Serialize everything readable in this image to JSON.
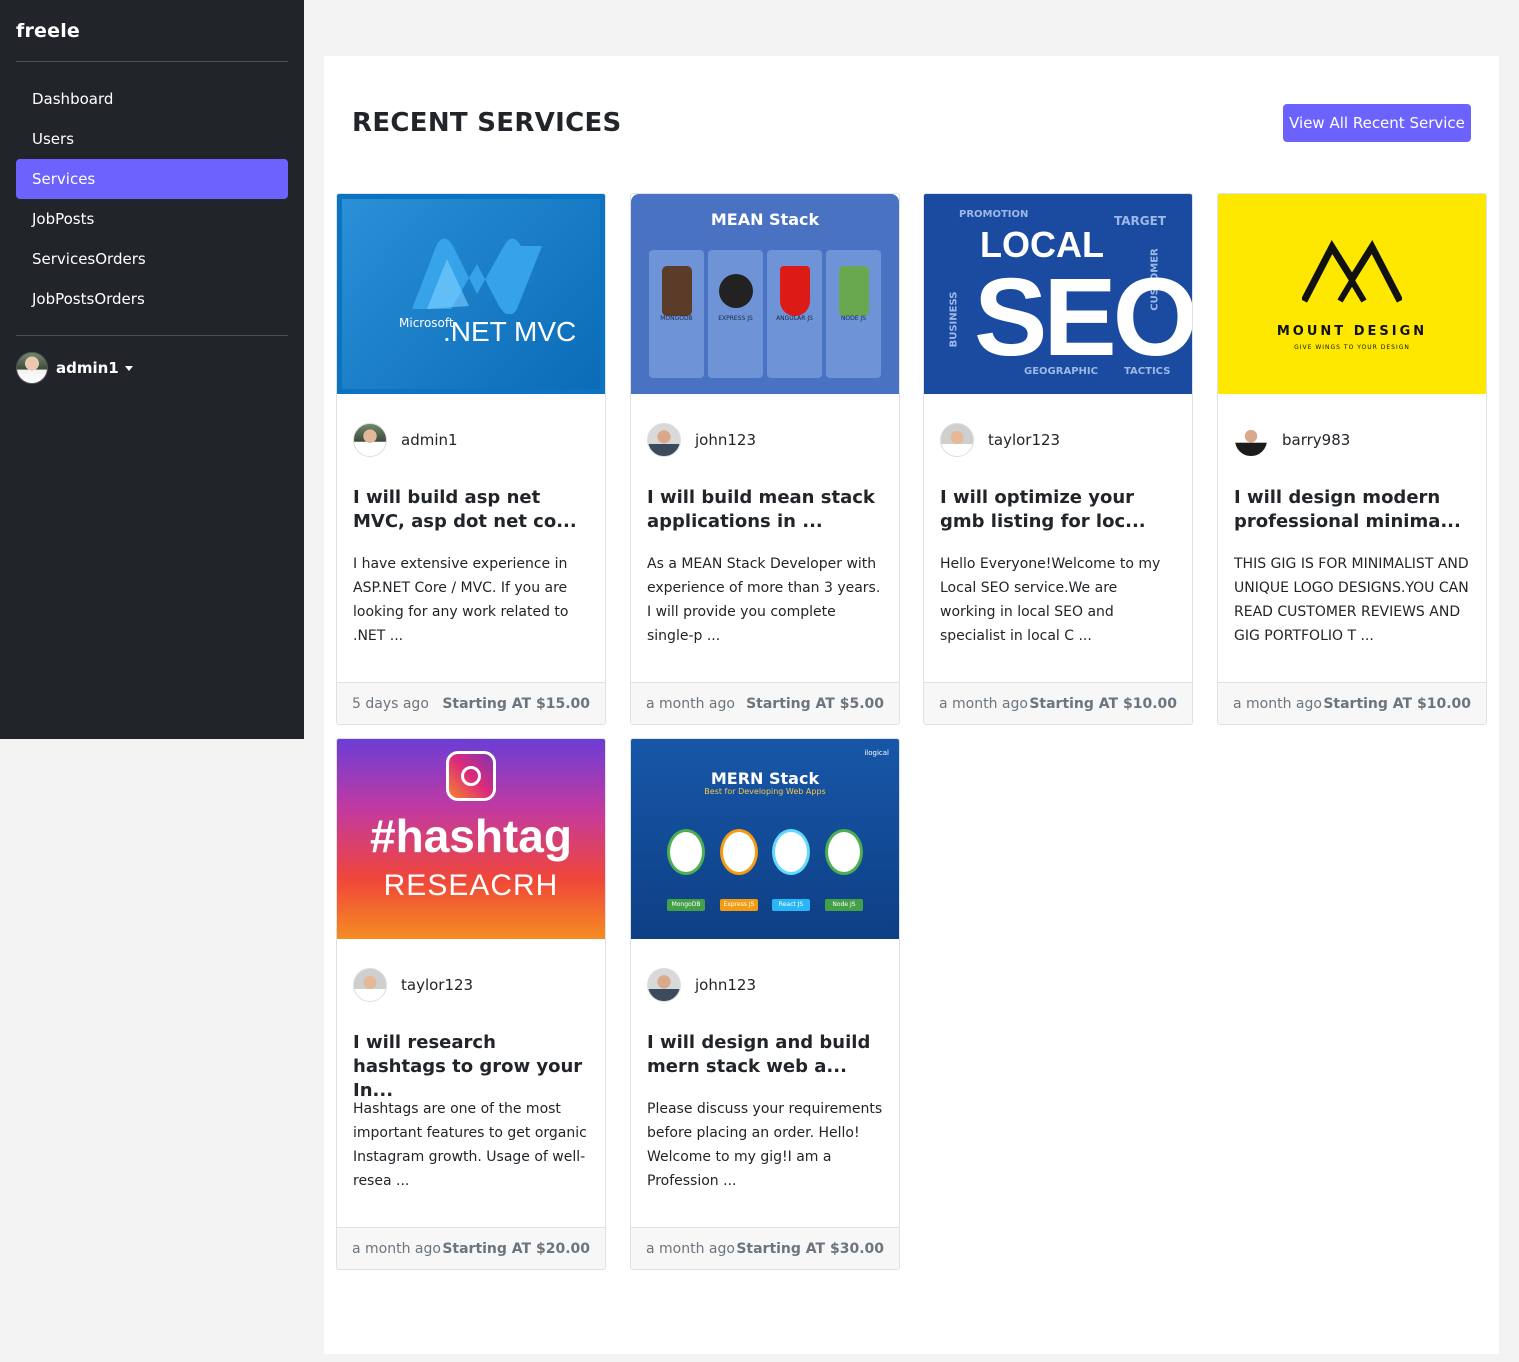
{
  "brand": "freele",
  "nav": [
    {
      "label": "Dashboard"
    },
    {
      "label": "Users"
    },
    {
      "label": "Services",
      "active": true
    },
    {
      "label": "JobPosts"
    },
    {
      "label": "ServicesOrders"
    },
    {
      "label": "JobPostsOrders"
    }
  ],
  "user": {
    "name": "admin1"
  },
  "main": {
    "title": "RECENT SERVICES",
    "view_all_label": "View All Recent Service"
  },
  "cards": [
    {
      "seller": "admin1",
      "title": "I will build asp net MVC, asp dot net co...",
      "desc": "I have extensive experience in ASP.NET Core / MVC. If you are looking for any work related to .NET ...",
      "time": "5 days ago",
      "price": "Starting AT $15.00",
      "thumb": {
        "small": "Microsoft",
        "main": ".NET MVC"
      }
    },
    {
      "seller": "john123",
      "title": "I will build mean stack applications in ...",
      "desc": "As a MEAN Stack Developer with experience of more than 3 years. I will provide you complete single-p ...",
      "time": "a month ago",
      "price": "Starting AT $5.00",
      "thumb": {
        "heading": "MEAN Stack",
        "items": [
          "MONGODB",
          "EXPRESS JS",
          "ANGULAR JS",
          "NODE JS"
        ]
      }
    },
    {
      "seller": "taylor123",
      "title": "I will optimize your gmb listing for loc...",
      "desc": "Hello Everyone!Welcome to my Local SEO service.We are working in local SEO and specialist in local C ...",
      "time": "a month ago",
      "price": "Starting AT $10.00",
      "thumb": {
        "line1": "LOCAL",
        "line2": "SEO",
        "words": [
          "PROMOTION",
          "TARGET",
          "BUSINESS",
          "CUSTOMER",
          "GEOGRAPHIC",
          "TACTICS"
        ]
      }
    },
    {
      "seller": "barry983",
      "title": "I will design modern professional minima...",
      "desc": "THIS GIG IS FOR MINIMALIST AND UNIQUE LOGO DESIGNS.YOU CAN READ CUSTOMER REVIEWS AND GIG PORTFOLIO T ...",
      "time": "a month ago",
      "price": "Starting AT $10.00",
      "thumb": {
        "name": "MOUNT DESIGN",
        "tagline": "GIVE WINGS TO YOUR DESIGN"
      }
    },
    {
      "seller": "taylor123",
      "title": "I will research hashtags to grow your In...",
      "desc": "Hashtags are one of the most important features to get organic Instagram growth. Usage of well-resea ...",
      "time": "a month ago",
      "price": "Starting AT $20.00",
      "thumb": {
        "line1": "#hashtag",
        "line2": "RESEACRH"
      }
    },
    {
      "seller": "john123",
      "title": "I will design and build mern stack web a...",
      "desc": "Please discuss your requirements before placing an order. Hello! Welcome to my gig!I am a Profession ...",
      "time": "a month ago",
      "price": "Starting AT $30.00",
      "thumb": {
        "heading": "MERN Stack",
        "sub": "Best for Developing Web Apps",
        "corner": "ilogical",
        "items": [
          "MongoDB",
          "Express JS",
          "React JS",
          "Node JS"
        ]
      }
    }
  ],
  "colors": {
    "accent": "#6c63ff",
    "sidebar": "#212529"
  }
}
